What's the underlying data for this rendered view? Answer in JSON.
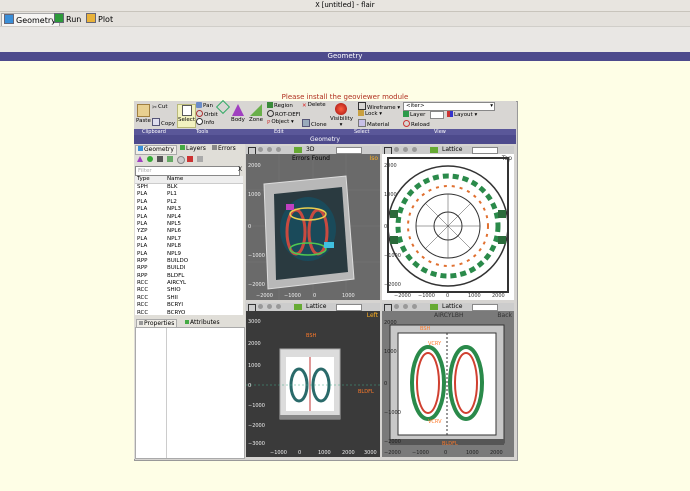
{
  "window": {
    "title": "[untitled] - flair"
  },
  "top_tabs": [
    {
      "label": "Geometry"
    },
    {
      "label": "Run"
    },
    {
      "label": "Plot"
    }
  ],
  "main_header": "Geometry",
  "install_message": "Please install the geoviewer module",
  "ribbon": {
    "paste": "Paste",
    "cut": "Cut",
    "copy": "Copy",
    "select": "Select",
    "pan": "Pan",
    "orbit": "Orbit",
    "info": "Info",
    "body": "Body",
    "zone": "Zone",
    "region": "Region",
    "delete": "Delete",
    "rot_defi": "ROT-DEFI",
    "object": "Object ▾",
    "clone": "Clone",
    "visibility": "Visibility ▾",
    "wireframe": "Wireframe ▾",
    "lock": "Lock ▾",
    "material": "Material",
    "iter": "<iter>",
    "layer": "Layer",
    "layout": "Layout ▾",
    "reload": "Reload"
  },
  "ribbon_groups": [
    "Clipboard",
    "Tools",
    "Edit",
    "Select",
    "View"
  ],
  "geometry_header": "Geometry",
  "left_tabs": {
    "geometry": "Geometry",
    "layers": "Layers",
    "errors": "Errors"
  },
  "filter": {
    "placeholder": "Filter",
    "clear": "X"
  },
  "table": {
    "headers": [
      "Type",
      "Name"
    ],
    "rows": [
      [
        "SPH",
        "BLK"
      ],
      [
        "PLA",
        "PL1"
      ],
      [
        "PLA",
        "PL2"
      ],
      [
        "PLA",
        "NPL3"
      ],
      [
        "PLA",
        "NPL4"
      ],
      [
        "PLA",
        "NPL5"
      ],
      [
        "YZP",
        "NPL6"
      ],
      [
        "PLA",
        "NPL7"
      ],
      [
        "PLA",
        "NPL8"
      ],
      [
        "PLA",
        "NPL9"
      ],
      [
        "RPP",
        "BUILDO"
      ],
      [
        "RPP",
        "BUILDI"
      ],
      [
        "RPP",
        "BLDFL"
      ],
      [
        "RCC",
        "AIRCYL"
      ],
      [
        "RCC",
        "SHIO"
      ],
      [
        "RCC",
        "SHII"
      ],
      [
        "RCC",
        "BCRYI"
      ],
      [
        "RCC",
        "BCRYO"
      ],
      [
        "RCC",
        "SCRYI"
      ],
      [
        "RCC",
        "SCRYO"
      ]
    ]
  },
  "prop_tabs": {
    "properties": "Properties",
    "attributes": "Attributes"
  },
  "viewports": {
    "v3d": {
      "label": "3D",
      "corner": "Iso",
      "error": "Errors Found",
      "ticks_y": [
        "2000",
        "1000",
        "0",
        "−1000",
        "−2000"
      ],
      "ticks_x": [
        "−2000",
        "−1000",
        "0",
        "1000"
      ]
    },
    "top": {
      "label": "Lattice",
      "corner": "Top",
      "ticks_y": [
        "2000",
        "1000",
        "0",
        "−1000",
        "−2000"
      ],
      "ticks_x": [
        "−2000",
        "−1000",
        "0",
        "1000",
        "2000"
      ]
    },
    "left": {
      "label": "Lattice",
      "corner": "Left",
      "region1": "BSH",
      "region2": "BLDFL",
      "ticks_y": [
        "3000",
        "2000",
        "1000",
        "0",
        "−1000",
        "−2000",
        "−3000"
      ],
      "ticks_x": [
        "−1000",
        "0",
        "1000",
        "2000",
        "3000"
      ]
    },
    "back": {
      "label": "Lattice",
      "corner": "Back",
      "top_label": "AIRCYLBH",
      "region_bsh": "BSH",
      "region_vcry": "VCRY",
      "region_vcrv": "VCRV",
      "region_bldfl": "BLDFL",
      "ticks_y": [
        "2000",
        "1000",
        "0",
        "−1000",
        "−2000"
      ],
      "ticks_x": [
        "−2000",
        "−1000",
        "0",
        "1000",
        "2000"
      ]
    }
  },
  "colors": {
    "header": "#4d4a8c",
    "background": "#fefee6",
    "region_label": "#ff7a2a",
    "error_text": "#e8302a"
  }
}
